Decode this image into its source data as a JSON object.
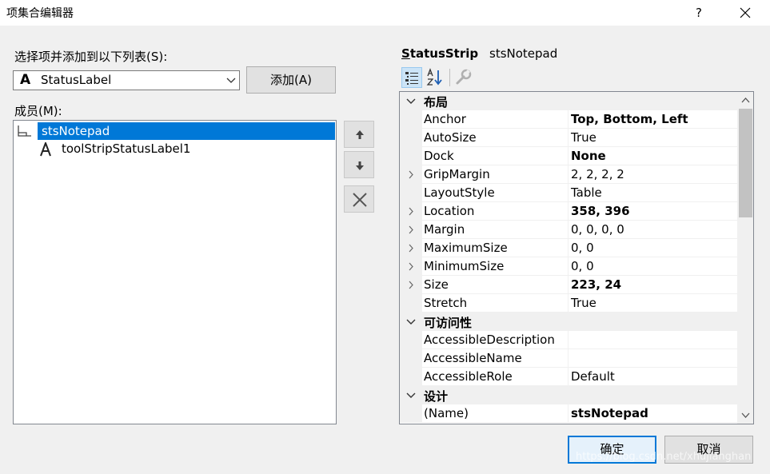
{
  "window": {
    "title": "项集合编辑器",
    "help_label": "?"
  },
  "left": {
    "add_section_label": "选择项并添加到以下列表(S):",
    "combo": {
      "glyph": "A",
      "value": "StatusLabel"
    },
    "add_button": "添加(A)",
    "members_label": "成员(M):",
    "members": [
      {
        "label": "stsNotepad",
        "icon": "statusstrip-icon",
        "selected": true
      },
      {
        "label": "toolStripStatusLabel1",
        "icon": "label-A-icon",
        "selected": false
      }
    ]
  },
  "properties": {
    "type_prefix": "S",
    "type_rest": "tatusStrip",
    "object_name": "stsNotepad",
    "categories": [
      {
        "label": "布局",
        "rows": [
          {
            "name": "Anchor",
            "value": "Top, Bottom, Left",
            "bold": true,
            "expandable": false
          },
          {
            "name": "AutoSize",
            "value": "True",
            "bold": false,
            "expandable": false
          },
          {
            "name": "Dock",
            "value": "None",
            "bold": true,
            "expandable": false
          },
          {
            "name": "GripMargin",
            "value": "2, 2, 2, 2",
            "bold": false,
            "expandable": true
          },
          {
            "name": "LayoutStyle",
            "value": "Table",
            "bold": false,
            "expandable": false
          },
          {
            "name": "Location",
            "value": "358, 396",
            "bold": true,
            "expandable": true
          },
          {
            "name": "Margin",
            "value": "0, 0, 0, 0",
            "bold": false,
            "expandable": true
          },
          {
            "name": "MaximumSize",
            "value": "0, 0",
            "bold": false,
            "expandable": true
          },
          {
            "name": "MinimumSize",
            "value": "0, 0",
            "bold": false,
            "expandable": true
          },
          {
            "name": "Size",
            "value": "223, 24",
            "bold": true,
            "expandable": true
          },
          {
            "name": "Stretch",
            "value": "True",
            "bold": false,
            "expandable": false
          }
        ]
      },
      {
        "label": "可访问性",
        "rows": [
          {
            "name": "AccessibleDescription",
            "value": "",
            "bold": false,
            "expandable": false
          },
          {
            "name": "AccessibleName",
            "value": "",
            "bold": false,
            "expandable": false
          },
          {
            "name": "AccessibleRole",
            "value": "Default",
            "bold": false,
            "expandable": false
          }
        ]
      },
      {
        "label": "设计",
        "rows": [
          {
            "name": "(Name)",
            "value": "stsNotepad",
            "bold": true,
            "expandable": false
          }
        ]
      }
    ]
  },
  "buttons": {
    "ok": "确定",
    "cancel": "取消"
  },
  "watermark": "https://blog.csdn.net/xhujianghan",
  "colors": {
    "selection": "#0078d7",
    "dialog_bg": "#f0f0f0"
  }
}
